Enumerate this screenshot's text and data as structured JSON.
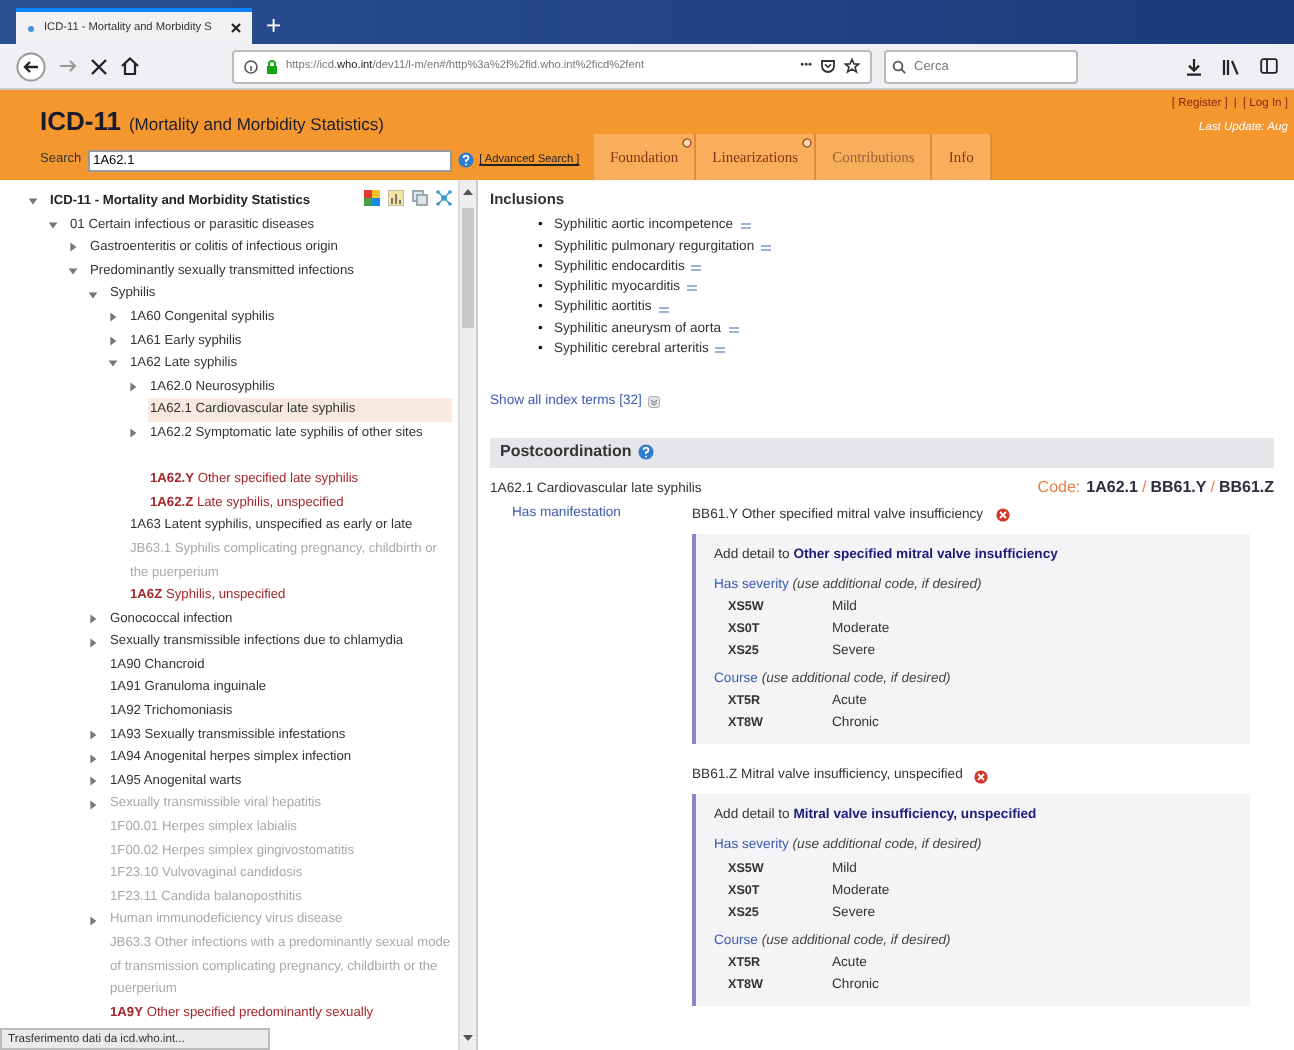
{
  "browser": {
    "tab_title": "ICD-11 - Mortality and Morbidity S",
    "new_tab": "+",
    "url_prefix": "https://icd.",
    "url_host": "who.int",
    "url_rest": "/dev11/l-m/en#/http%3a%2f%2fid.who.int%2ficd%2fent",
    "page_actions": "•••",
    "search_placeholder": "Cerca"
  },
  "site": {
    "title": "ICD-11",
    "subtitle": "(Mortality and Morbidity Statistics)",
    "register": "[ Register ]",
    "separator": "|",
    "login": "[ Log In ]",
    "last_update": "Last Update: Aug",
    "search_label": "Search",
    "search_value": "1A62.1",
    "advanced_search": "[ Advanced Search ]",
    "tabs": [
      {
        "label": "Foundation",
        "info": true,
        "disabled": false
      },
      {
        "label": "Linearizations",
        "info": true,
        "disabled": false
      },
      {
        "label": "Contributions",
        "info": false,
        "disabled": true
      },
      {
        "label": "Info",
        "info": false,
        "disabled": false
      }
    ]
  },
  "tree": [
    {
      "title": "ICD-11 - Mortality and Morbidity Statistics",
      "kind": "root",
      "expanded": true,
      "selected": false,
      "children": [
        {
          "code": "01",
          "title": "Certain infectious or parasitic diseases",
          "kind": "normal",
          "expanded": true,
          "selected": false,
          "children": [
            {
              "title": "Gastroenteritis or colitis of infectious origin",
              "kind": "normal",
              "expanded": false,
              "selected": false
            },
            {
              "title": "Predominantly sexually transmitted infections",
              "kind": "normal",
              "expanded": true,
              "selected": false,
              "children": [
                {
                  "title": "Syphilis",
                  "kind": "normal",
                  "expanded": true,
                  "selected": false,
                  "children": [
                    {
                      "code": "1A60",
                      "title": "Congenital syphilis",
                      "kind": "normal",
                      "expanded": false,
                      "selected": false
                    },
                    {
                      "code": "1A61",
                      "title": "Early syphilis",
                      "kind": "normal",
                      "expanded": false,
                      "selected": false
                    },
                    {
                      "code": "1A62",
                      "title": "Late syphilis",
                      "kind": "normal",
                      "expanded": true,
                      "selected": false,
                      "children": [
                        {
                          "code": "1A62.0",
                          "title": "Neurosyphilis",
                          "kind": "normal",
                          "expanded": false,
                          "selected": false
                        },
                        {
                          "code": "1A62.1",
                          "title": "Cardiovascular late syphilis",
                          "kind": "normal",
                          "selected": true
                        },
                        {
                          "code": "1A62.2",
                          "title": "Symptomatic late syphilis of other sites",
                          "kind": "normal",
                          "expanded": false,
                          "selected": false
                        },
                        {
                          "code": "1A62.Y",
                          "title": "Other specified late syphilis",
                          "kind": "residual",
                          "selected": false
                        },
                        {
                          "code": "1A62.Z",
                          "title": "Late syphilis, unspecified",
                          "kind": "residual",
                          "selected": false
                        }
                      ]
                    },
                    {
                      "code": "1A63",
                      "title": "Latent syphilis, unspecified as early or late",
                      "kind": "normal",
                      "selected": false
                    },
                    {
                      "code": "JB63.1",
                      "title": "Syphilis complicating pregnancy, childbirth or the puerperium",
                      "kind": "foreign",
                      "selected": false
                    },
                    {
                      "code": "1A6Z",
                      "title": "Syphilis, unspecified",
                      "kind": "residual",
                      "selected": false
                    }
                  ]
                },
                {
                  "title": "Gonococcal infection",
                  "kind": "normal",
                  "expanded": false,
                  "selected": false
                },
                {
                  "title": "Sexually transmissible infections due to chlamydia",
                  "kind": "normal",
                  "expanded": false,
                  "selected": false
                },
                {
                  "code": "1A90",
                  "title": "Chancroid",
                  "kind": "normal",
                  "selected": false
                },
                {
                  "code": "1A91",
                  "title": "Granuloma inguinale",
                  "kind": "normal",
                  "selected": false
                },
                {
                  "code": "1A92",
                  "title": "Trichomoniasis",
                  "kind": "normal",
                  "selected": false
                },
                {
                  "code": "1A93",
                  "title": "Sexually transmissible infestations",
                  "kind": "normal",
                  "expanded": false,
                  "selected": false
                },
                {
                  "code": "1A94",
                  "title": "Anogenital herpes simplex infection",
                  "kind": "normal",
                  "expanded": false,
                  "selected": false
                },
                {
                  "code": "1A95",
                  "title": "Anogenital warts",
                  "kind": "normal",
                  "expanded": false,
                  "selected": false
                },
                {
                  "title": "Sexually transmissible viral hepatitis",
                  "kind": "foreign",
                  "expanded": false,
                  "selected": false
                },
                {
                  "code": "1F00.01",
                  "title": "Herpes simplex labialis",
                  "kind": "foreign",
                  "selected": false
                },
                {
                  "code": "1F00.02",
                  "title": "Herpes simplex gingivostomatitis",
                  "kind": "foreign",
                  "selected": false
                },
                {
                  "code": "1F23.10",
                  "title": "Vulvovaginal candidosis",
                  "kind": "foreign",
                  "selected": false
                },
                {
                  "code": "1F23.11",
                  "title": "Candida balanoposthitis",
                  "kind": "foreign",
                  "selected": false
                },
                {
                  "title": "Human immunodeficiency virus disease",
                  "kind": "foreign",
                  "expanded": false,
                  "selected": false
                },
                {
                  "code": "JB63.3",
                  "title": "Other infections with a predominantly sexual mode of transmission complicating pregnancy, childbirth or the puerperium",
                  "kind": "foreign",
                  "selected": false
                },
                {
                  "code": "1A9Y",
                  "title": "Other specified predominantly sexually",
                  "kind": "residual",
                  "selected": false
                }
              ]
            }
          ]
        }
      ]
    }
  ],
  "inclusions": {
    "heading": "Inclusions",
    "items": [
      {
        "bullet": "•",
        "text": "Syphilitic aortic incompetence"
      },
      {
        "bullet": "•",
        "text": "Syphilitic pulmonary regurgitation"
      },
      {
        "bullet": "•",
        "text": "Syphilitic endocarditis"
      },
      {
        "bullet": "•",
        "text": "Syphilitic myocarditis"
      },
      {
        "bullet": "•",
        "text": "Syphilitic aortitis"
      },
      {
        "bullet": "•",
        "text": "Syphilitic aneurysm of aorta"
      },
      {
        "bullet": "•",
        "text": "Syphilitic cerebral arteritis"
      }
    ],
    "show_all": "Show all index terms [32]"
  },
  "postcoordination": {
    "heading": "Postcoordination",
    "stem": "1A62.1 Cardiovascular late syphilis",
    "code_label": "Code:",
    "code_parts": [
      {
        "kind": "code",
        "text": "1A62.1"
      },
      {
        "kind": "separator",
        "text": "/"
      },
      {
        "kind": "code",
        "text": "BB61.Y"
      },
      {
        "kind": "separator",
        "text": "/"
      },
      {
        "kind": "code",
        "text": "BB61.Z"
      }
    ],
    "axis_label": "Has manifestation",
    "manifestations": [
      {
        "code": "BB61.Y",
        "title": "Other specified mitral valve insufficiency",
        "detail_prefix": "Add detail to",
        "detail_target": "Other specified mitral valve insufficiency",
        "axes": [
          {
            "name": "Has severity",
            "note": "(use additional code, if desired)",
            "options": [
              {
                "code": "XS5W",
                "label": "Mild"
              },
              {
                "code": "XS0T",
                "label": "Moderate"
              },
              {
                "code": "XS25",
                "label": "Severe"
              }
            ]
          },
          {
            "name": "Course",
            "note": "(use additional code, if desired)",
            "options": [
              {
                "code": "XT5R",
                "label": "Acute"
              },
              {
                "code": "XT8W",
                "label": "Chronic"
              }
            ]
          }
        ]
      },
      {
        "code": "BB61.Z",
        "title": "Mitral valve insufficiency, unspecified",
        "detail_prefix": "Add detail to",
        "detail_target": "Mitral valve insufficiency, unspecified",
        "axes": [
          {
            "name": "Has severity",
            "note": "(use additional code, if desired)",
            "options": [
              {
                "code": "XS5W",
                "label": "Mild"
              },
              {
                "code": "XS0T",
                "label": "Moderate"
              },
              {
                "code": "XS25",
                "label": "Severe"
              }
            ]
          },
          {
            "name": "Course",
            "note": "(use additional code, if desired)",
            "options": [
              {
                "code": "XT5R",
                "label": "Acute"
              },
              {
                "code": "XT8W",
                "label": "Chronic"
              }
            ]
          }
        ]
      }
    ]
  },
  "status_bar": "Trasferimento dati da icd.who.int..."
}
